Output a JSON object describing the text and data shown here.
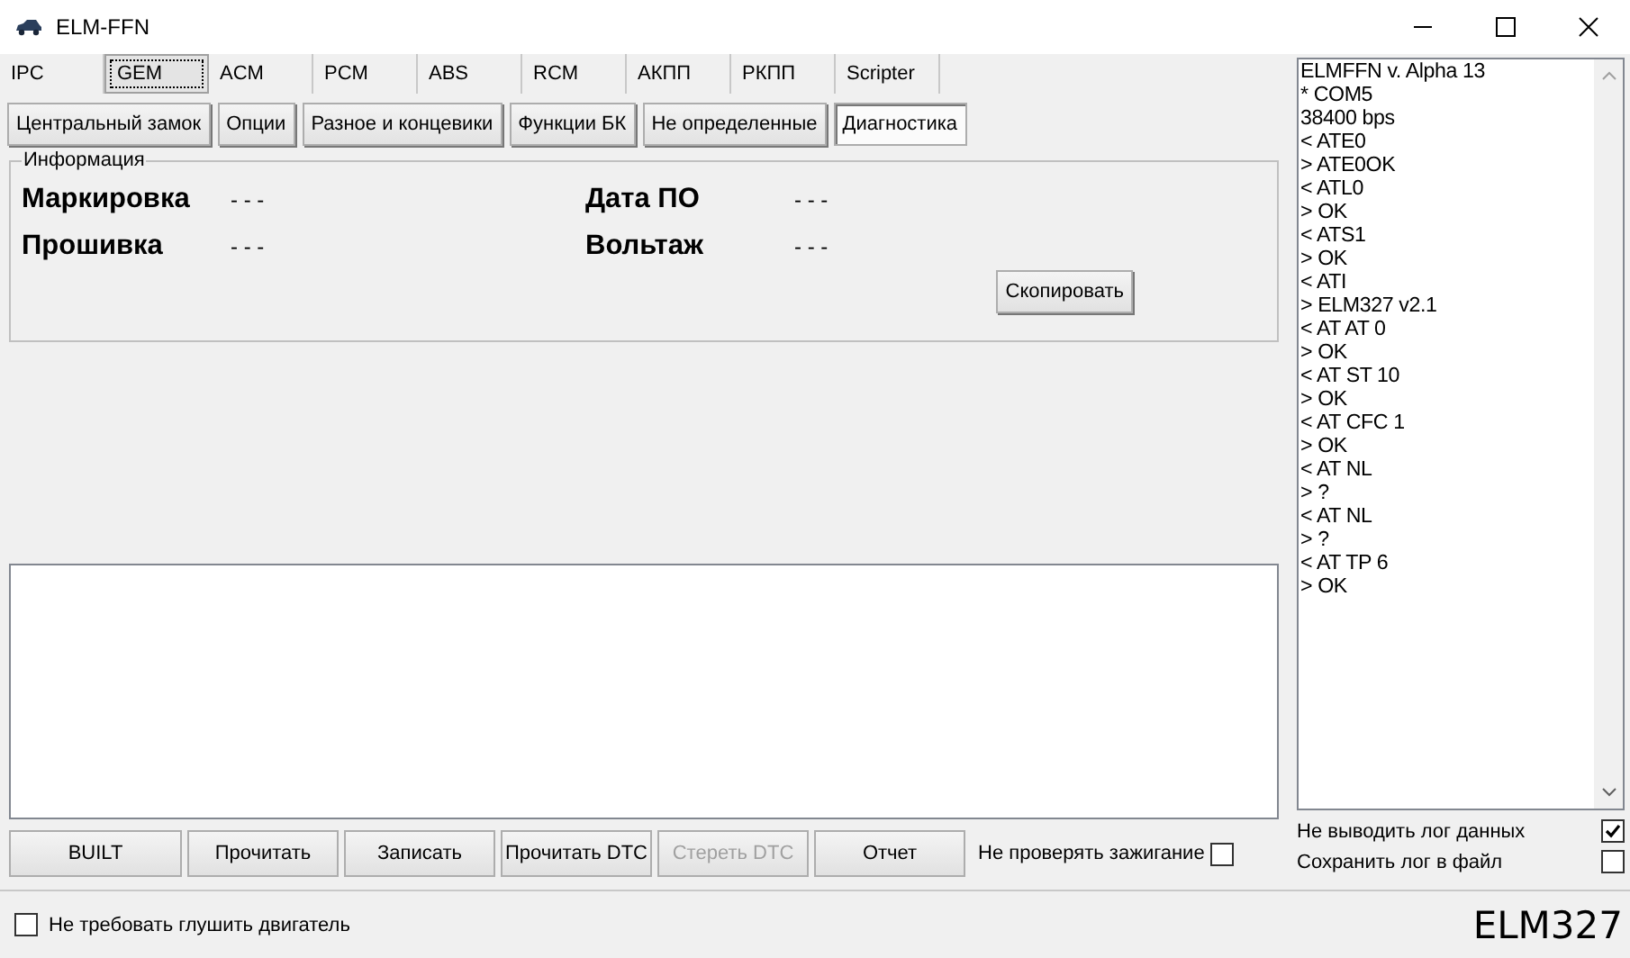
{
  "window": {
    "title": "ELM-FFN"
  },
  "tabs": [
    {
      "label": "IPC",
      "selected": false
    },
    {
      "label": "GEM",
      "selected": true
    },
    {
      "label": "ACM",
      "selected": false
    },
    {
      "label": "PCM",
      "selected": false
    },
    {
      "label": "ABS",
      "selected": false
    },
    {
      "label": "RCM",
      "selected": false
    },
    {
      "label": "АКПП",
      "selected": false
    },
    {
      "label": "РКПП",
      "selected": false
    },
    {
      "label": "Scripter",
      "selected": false
    }
  ],
  "subtabs": [
    {
      "label": "Центральный замок",
      "selected": false
    },
    {
      "label": "Опции",
      "selected": false
    },
    {
      "label": "Разное и концевики",
      "selected": false
    },
    {
      "label": "Функции БК",
      "selected": false
    },
    {
      "label": "Не определенные",
      "selected": false
    },
    {
      "label": "Диагностика",
      "selected": true
    }
  ],
  "info": {
    "title": "Информация",
    "fields": [
      {
        "label": "Маркировка",
        "value": "- - -"
      },
      {
        "label": "Дата ПО",
        "value": "- - -"
      },
      {
        "label": "Прошивка",
        "value": "- - -"
      },
      {
        "label": "Вольтаж",
        "value": "- - -"
      }
    ],
    "copy_button": "Скопировать"
  },
  "actions": [
    {
      "kind": "button",
      "label": "BUILT",
      "disabled": false
    },
    {
      "kind": "button",
      "label": "Прочитать",
      "disabled": false
    },
    {
      "kind": "button",
      "label": "Записать",
      "disabled": false
    },
    {
      "kind": "button",
      "label": "Прочитать DTC",
      "disabled": false
    },
    {
      "kind": "button",
      "label": "Стереть DTC",
      "disabled": true
    },
    {
      "kind": "button",
      "label": "Отчет",
      "disabled": false
    },
    {
      "kind": "checkbox",
      "label": "Не проверять зажигание",
      "checked": false
    }
  ],
  "log": [
    "ELMFFN v. Alpha 13",
    "* COM5",
    "38400 bps",
    "< ATE0",
    "> ATE0OK",
    "< ATL0",
    "> OK",
    "< ATS1",
    "> OK",
    "< ATI",
    "> ELM327 v2.1",
    "< AT AT 0",
    "> OK",
    "< AT ST 10",
    "> OK",
    "< AT CFC 1",
    "> OK",
    "< AT NL",
    "> ?",
    "< AT NL",
    "> ?",
    "< AT TP 6",
    "> OK"
  ],
  "log_options": [
    {
      "label": "Не выводить лог данных",
      "checked": true
    },
    {
      "label": "Сохранить лог в файл",
      "checked": false
    }
  ],
  "status_bar": {
    "option": {
      "label": "Не требовать глушить двигатель",
      "checked": false
    },
    "adapter": "ELM327"
  }
}
